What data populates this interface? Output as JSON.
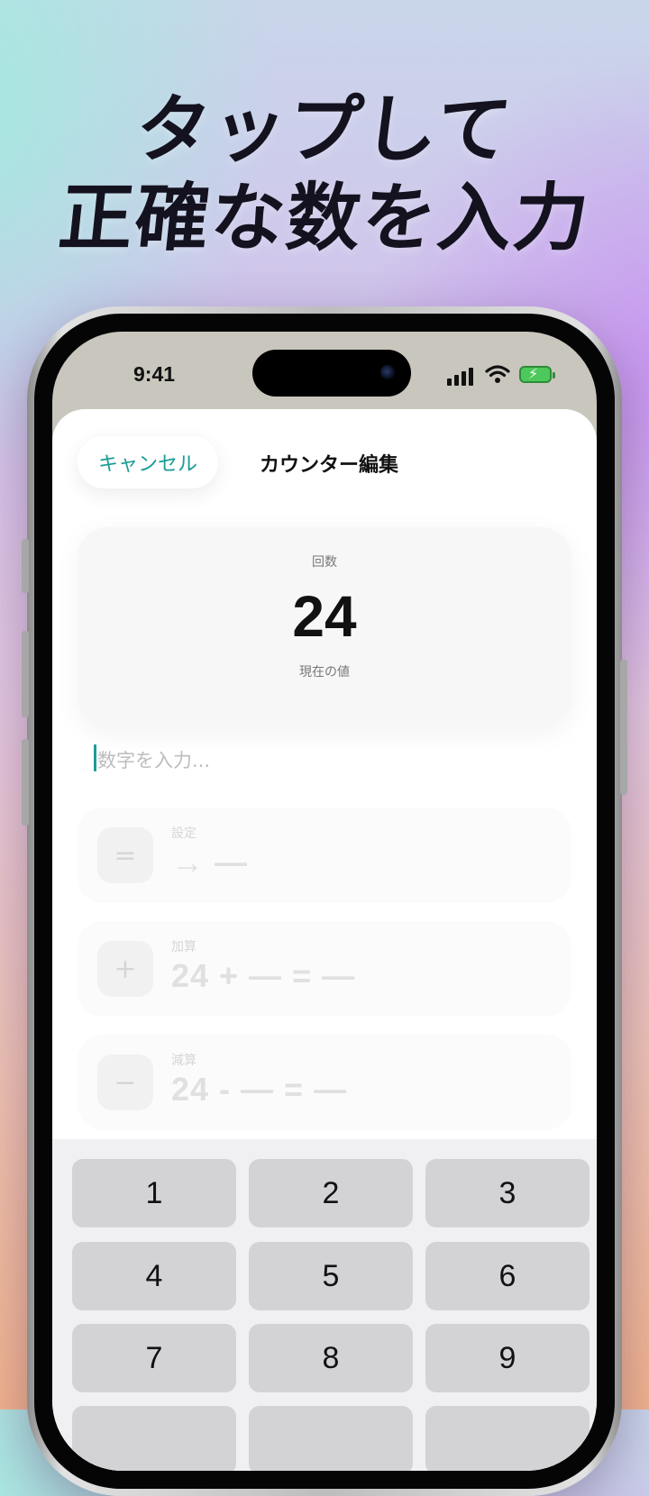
{
  "headline": {
    "line1": "タップして",
    "line2": "正確な数を入力"
  },
  "status": {
    "time": "9:41"
  },
  "nav": {
    "cancel": "キャンセル",
    "title": "カウンター編集"
  },
  "value_card": {
    "label": "回数",
    "value": "24",
    "caption": "現在の値"
  },
  "input": {
    "placeholder": "数字を入力..."
  },
  "operations": [
    {
      "icon": "=",
      "label": "設定",
      "expr": "→ —"
    },
    {
      "icon": "+",
      "label": "加算",
      "expr": "24 + — = —"
    },
    {
      "icon": "−",
      "label": "減算",
      "expr": "24 - — = —"
    }
  ],
  "keypad": {
    "keys": [
      "1",
      "2",
      "3",
      "4",
      "5",
      "6",
      "7",
      "8",
      "9"
    ]
  },
  "colors": {
    "accent": "#1a9c96",
    "key_bg": "#d3d3d6",
    "battery": "#4cc95a"
  }
}
